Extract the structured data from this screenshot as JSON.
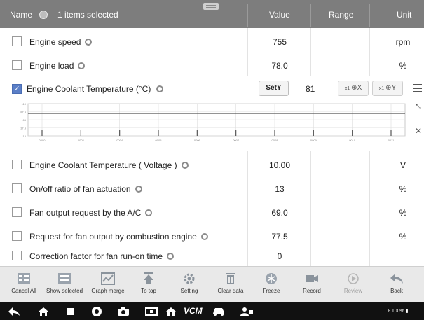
{
  "header": {
    "name_label": "Name",
    "selection_text": "1 items selected",
    "value_label": "Value",
    "range_label": "Range",
    "unit_label": "Unit"
  },
  "rows": [
    {
      "label": "Engine speed",
      "value": "755",
      "unit": "rpm"
    },
    {
      "label": "Engine load",
      "value": "78.0",
      "unit": "%"
    }
  ],
  "expanded": {
    "label": "Engine Coolant Temperature   (°C)",
    "sety_label": "SetY",
    "value": "81",
    "zoom_x_label": "X",
    "zoom_y_label": "Y",
    "zoom_prefix": "x1",
    "chart_data": {
      "type": "line",
      "x": [
        0,
        10
      ],
      "y": [
        81,
        81
      ],
      "y_ticks": [
        "110",
        "87.5",
        "65",
        "37.5",
        "15"
      ],
      "x_ticks": [
        "0000",
        "0003",
        "0004",
        "0005",
        "0006",
        "0007",
        "0008",
        "0009",
        "0010",
        "0011"
      ],
      "grid": true
    }
  },
  "rows2": [
    {
      "label": "Engine Coolant Temperature ( Voltage )",
      "value": "10.00",
      "unit": "V"
    },
    {
      "label": "On/off ratio of fan actuation",
      "value": "13",
      "unit": "%"
    },
    {
      "label": "Fan output request by the A/C",
      "value": "69.0",
      "unit": "%"
    },
    {
      "label": "Request for fan output by combustion engine",
      "value": "77.5",
      "unit": "%"
    },
    {
      "label": "Correction factor for fan run-on time",
      "value": "0",
      "unit": ""
    }
  ],
  "toolbar": [
    {
      "label": "Cancel All",
      "icon": "cancel-all-icon"
    },
    {
      "label": "Show selected",
      "icon": "show-selected-icon"
    },
    {
      "label": "Graph merge",
      "icon": "graph-merge-icon"
    },
    {
      "label": "To top",
      "icon": "to-top-icon"
    },
    {
      "label": "Setting",
      "icon": "setting-icon"
    },
    {
      "label": "Clear data",
      "icon": "clear-data-icon"
    },
    {
      "label": "Freeze",
      "icon": "freeze-icon"
    },
    {
      "label": "Record",
      "icon": "record-icon"
    },
    {
      "label": "Review",
      "icon": "review-icon"
    },
    {
      "label": "Back",
      "icon": "back-icon"
    }
  ],
  "navbar": {
    "vcm_label": "VCM",
    "status_text": "100%"
  },
  "colors": {
    "header_bg": "#7d7d7d",
    "check_blue": "#5b7fc7",
    "navbar_bg": "#111111"
  }
}
